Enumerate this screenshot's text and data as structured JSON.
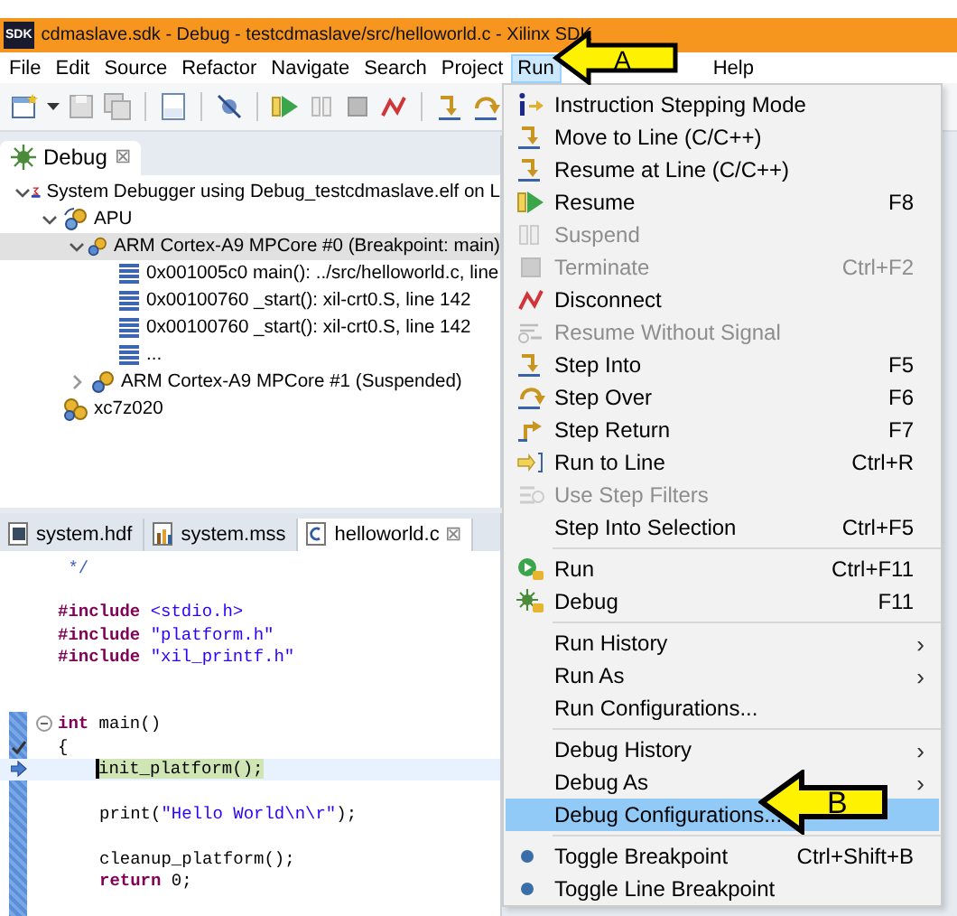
{
  "window": {
    "logo": "SDK",
    "title": "cdmaslave.sdk - Debug - testcdmaslave/src/helloworld.c - Xilinx SDK"
  },
  "menubar": [
    {
      "label": "File",
      "selected": false
    },
    {
      "label": "Edit",
      "selected": false
    },
    {
      "label": "Source",
      "selected": false
    },
    {
      "label": "Refactor",
      "selected": false
    },
    {
      "label": "Navigate",
      "selected": false
    },
    {
      "label": "Search",
      "selected": false
    },
    {
      "label": "Project",
      "selected": false
    },
    {
      "label": "Run",
      "selected": true
    },
    {
      "label": "Help",
      "selected": false
    }
  ],
  "debug_view": {
    "tab": {
      "label": "Debug",
      "close": "⊠"
    },
    "tree": [
      {
        "kind": "launch",
        "label": "System Debugger using Debug_testcdmaslave.elf on L",
        "expanded": true,
        "selected": false,
        "children": [
          {
            "kind": "group",
            "label": "APU",
            "expanded": true,
            "selected": false,
            "children": [
              {
                "kind": "core",
                "label": "ARM Cortex-A9 MPCore #0 (Breakpoint: main)",
                "expanded": true,
                "selected": true,
                "children": [
                  {
                    "kind": "frame",
                    "label": "0x001005c0 main(): ../src/helloworld.c, line",
                    "selected": false
                  },
                  {
                    "kind": "frame",
                    "label": "0x00100760 _start(): xil-crt0.S, line 142",
                    "selected": false
                  },
                  {
                    "kind": "frame",
                    "label": "0x00100760 _start(): xil-crt0.S, line 142",
                    "selected": false
                  },
                  {
                    "kind": "frame",
                    "label": "...",
                    "selected": false
                  }
                ]
              },
              {
                "kind": "core",
                "label": "ARM Cortex-A9 MPCore #1 (Suspended)",
                "expanded": false,
                "selected": false
              }
            ]
          },
          {
            "kind": "target",
            "label": "xc7z020",
            "selected": false
          }
        ]
      }
    ]
  },
  "editor": {
    "tabs": [
      {
        "kind": "hdf",
        "label": "system.hdf",
        "selected": false
      },
      {
        "kind": "mss",
        "label": "system.mss",
        "selected": false
      },
      {
        "kind": "c",
        "label": "helloworld.c",
        "selected": true,
        "close": "⊠"
      }
    ],
    "lines": [
      {
        "kind": "code",
        "segments": [
          {
            "kind": "comment",
            "text": " */"
          }
        ]
      },
      {
        "kind": "blank"
      },
      {
        "kind": "code",
        "segments": [
          {
            "kind": "directive",
            "text": "#include "
          },
          {
            "kind": "header",
            "text": "<stdio.h>"
          }
        ]
      },
      {
        "kind": "code",
        "segments": [
          {
            "kind": "directive",
            "text": "#include "
          },
          {
            "kind": "string",
            "text": "\"platform.h\""
          }
        ]
      },
      {
        "kind": "code",
        "segments": [
          {
            "kind": "directive",
            "text": "#include "
          },
          {
            "kind": "string",
            "text": "\"xil_printf.h\""
          }
        ]
      },
      {
        "kind": "blank"
      },
      {
        "kind": "blank"
      },
      {
        "kind": "code",
        "fold": true,
        "segments": [
          {
            "kind": "keyword",
            "text": "int"
          },
          {
            "kind": "plain",
            "text": " main()"
          }
        ]
      },
      {
        "kind": "code",
        "breakpoint": true,
        "segments": [
          {
            "kind": "plain",
            "text": "{"
          }
        ]
      },
      {
        "kind": "code",
        "current": true,
        "indented": true,
        "segments": [
          {
            "kind": "plain",
            "text": "init_platform();"
          }
        ]
      },
      {
        "kind": "blank"
      },
      {
        "kind": "code",
        "indented": true,
        "segments": [
          {
            "kind": "plain",
            "text": "print("
          },
          {
            "kind": "string",
            "text": "\"Hello World\\n\\r\""
          },
          {
            "kind": "plain",
            "text": ");"
          }
        ]
      },
      {
        "kind": "blank"
      },
      {
        "kind": "code",
        "indented": true,
        "segments": [
          {
            "kind": "plain",
            "text": "cleanup_platform();"
          }
        ]
      },
      {
        "kind": "code",
        "indented": true,
        "segments": [
          {
            "kind": "keyword",
            "text": "return"
          },
          {
            "kind": "plain",
            "text": " 0;"
          }
        ]
      }
    ]
  },
  "run_menu": [
    {
      "kind": "item",
      "label": "Instruction Stepping Mode",
      "disabled": false,
      "submenu": false,
      "selected": false
    },
    {
      "kind": "item",
      "label": "Move to Line (C/C++)",
      "disabled": false,
      "submenu": false,
      "selected": false
    },
    {
      "kind": "item",
      "label": "Resume at Line (C/C++)",
      "disabled": false,
      "submenu": false,
      "selected": false
    },
    {
      "kind": "item",
      "label": "Resume",
      "shortcut": "F8",
      "disabled": false,
      "submenu": false,
      "selected": false
    },
    {
      "kind": "item",
      "label": "Suspend",
      "disabled": true,
      "submenu": false,
      "selected": false
    },
    {
      "kind": "item",
      "label": "Terminate",
      "shortcut": "Ctrl+F2",
      "disabled": true,
      "submenu": false,
      "selected": false
    },
    {
      "kind": "item",
      "label": "Disconnect",
      "disabled": false,
      "submenu": false,
      "selected": false
    },
    {
      "kind": "item",
      "label": "Resume Without Signal",
      "disabled": true,
      "submenu": false,
      "selected": false
    },
    {
      "kind": "item",
      "label": "Step Into",
      "shortcut": "F5",
      "disabled": false,
      "submenu": false,
      "selected": false
    },
    {
      "kind": "item",
      "label": "Step Over",
      "shortcut": "F6",
      "disabled": false,
      "submenu": false,
      "selected": false
    },
    {
      "kind": "item",
      "label": "Step Return",
      "shortcut": "F7",
      "disabled": false,
      "submenu": false,
      "selected": false
    },
    {
      "kind": "item",
      "label": "Run to Line",
      "shortcut": "Ctrl+R",
      "disabled": false,
      "submenu": false,
      "selected": false
    },
    {
      "kind": "item",
      "label": "Use Step Filters",
      "disabled": true,
      "submenu": false,
      "selected": false
    },
    {
      "kind": "item",
      "label": "Step Into Selection",
      "shortcut": "Ctrl+F5",
      "disabled": false,
      "submenu": false,
      "selected": false
    },
    {
      "kind": "separator"
    },
    {
      "kind": "item",
      "label": "Run",
      "shortcut": "Ctrl+F11",
      "disabled": false,
      "submenu": false,
      "selected": false
    },
    {
      "kind": "item",
      "label": "Debug",
      "shortcut": "F11",
      "disabled": false,
      "submenu": false,
      "selected": false
    },
    {
      "kind": "separator"
    },
    {
      "kind": "item",
      "label": "Run History",
      "disabled": false,
      "submenu": true,
      "selected": false
    },
    {
      "kind": "item",
      "label": "Run As",
      "disabled": false,
      "submenu": true,
      "selected": false
    },
    {
      "kind": "item",
      "label": "Run Configurations...",
      "disabled": false,
      "submenu": false,
      "selected": false
    },
    {
      "kind": "separator"
    },
    {
      "kind": "item",
      "label": "Debug History",
      "disabled": false,
      "submenu": true,
      "selected": false
    },
    {
      "kind": "item",
      "label": "Debug As",
      "disabled": false,
      "submenu": true,
      "selected": false
    },
    {
      "kind": "item",
      "label": "Debug Configurations...",
      "disabled": false,
      "submenu": false,
      "selected": true
    },
    {
      "kind": "separator"
    },
    {
      "kind": "item",
      "label": "Toggle Breakpoint",
      "shortcut": "Ctrl+Shift+B",
      "disabled": false,
      "submenu": false,
      "selected": false
    },
    {
      "kind": "item",
      "label": "Toggle Line Breakpoint",
      "disabled": false,
      "submenu": false,
      "selected": false
    }
  ],
  "annotations": [
    {
      "kind": "arrow",
      "label": "A"
    },
    {
      "kind": "arrow",
      "label": "B"
    }
  ],
  "submenu_chevron": "›"
}
